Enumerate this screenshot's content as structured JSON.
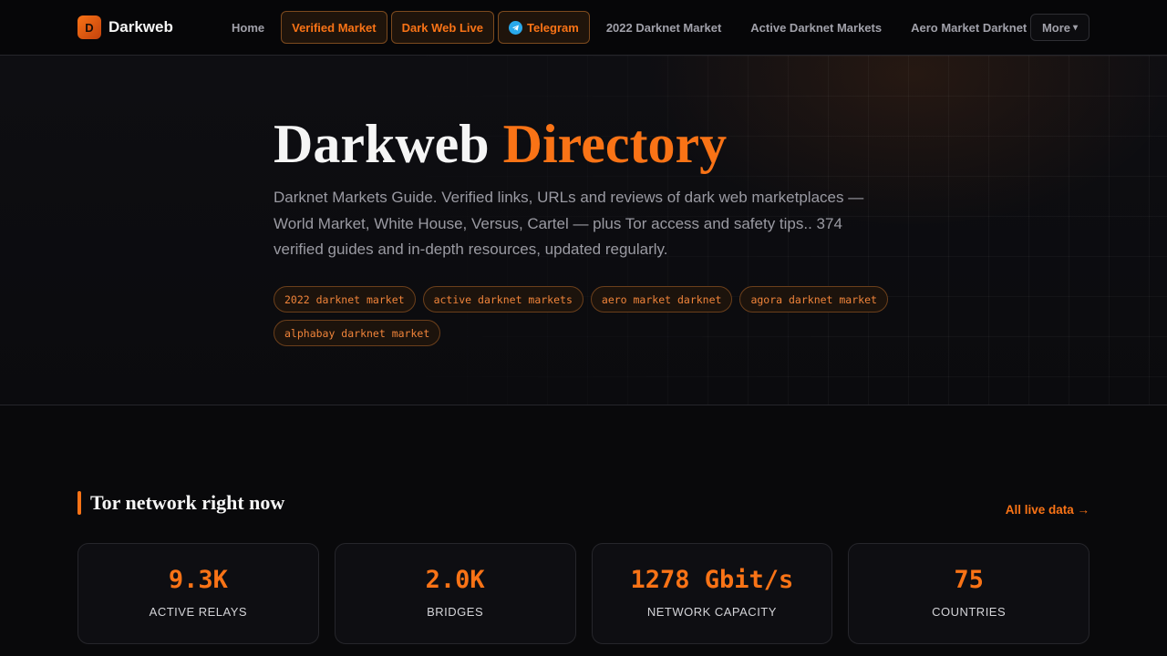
{
  "brand": {
    "logo_letter": "D",
    "name": "Darkweb"
  },
  "nav": {
    "links": [
      {
        "label": "Home",
        "highlighted": false
      },
      {
        "label": "Verified Market",
        "highlighted": true
      },
      {
        "label": "Dark Web Live",
        "highlighted": true
      },
      {
        "label": "Telegram",
        "highlighted": true,
        "icon": "telegram-icon"
      },
      {
        "label": "2022 Darknet Market",
        "highlighted": false
      },
      {
        "label": "Active Darknet Markets",
        "highlighted": false
      },
      {
        "label": "Aero Market Darknet",
        "highlighted": false
      }
    ],
    "more_label": "More",
    "more_icon": "▾"
  },
  "hero": {
    "title_main": "Darkweb",
    "title_accent": "Directory",
    "description": "Darknet Markets Guide. Verified links, URLs and reviews of dark web marketplaces — World Market, White House, Versus, Cartel — plus Tor access and safety tips.. 374 verified guides and in-depth resources, updated regularly.",
    "tags": [
      "2022 darknet market",
      "active darknet markets",
      "aero market darknet",
      "agora darknet market",
      "alphabay darknet market"
    ]
  },
  "tor_section": {
    "title": "Tor network right now",
    "link_label": "All live data →",
    "stats": [
      {
        "value": "9.3K",
        "label": "ACTIVE RELAYS"
      },
      {
        "value": "2.0K",
        "label": "BRIDGES"
      },
      {
        "value": "1278 Gbit/s",
        "label": "NETWORK CAPACITY"
      },
      {
        "value": "75",
        "label": "COUNTRIES"
      }
    ]
  },
  "colors": {
    "accent": "#f97316",
    "background": "#09090b",
    "telegram": "#29a9eb"
  }
}
